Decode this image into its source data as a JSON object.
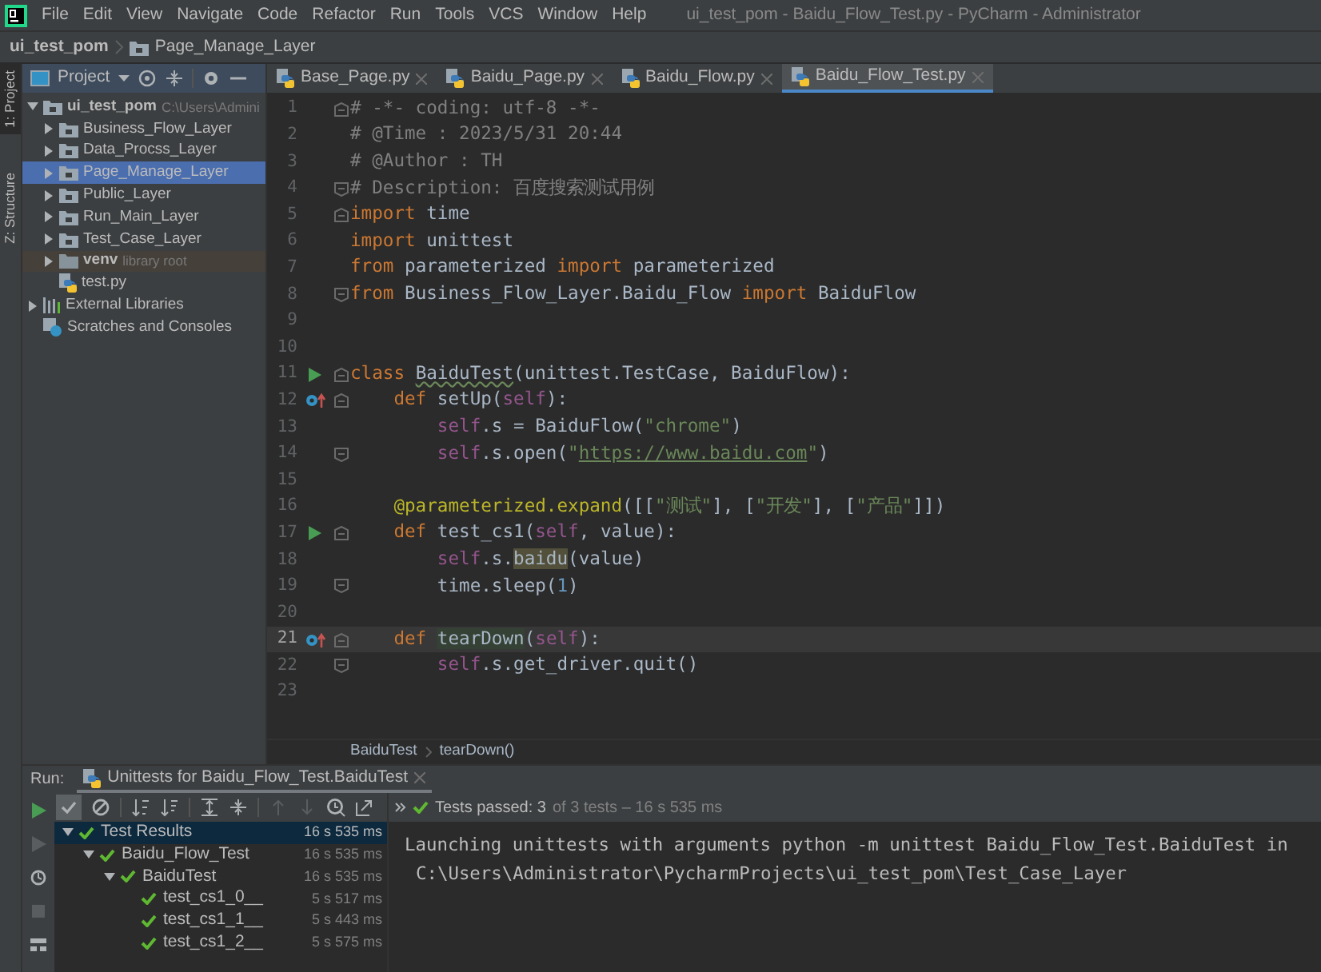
{
  "menu_bar": {
    "items": [
      "File",
      "Edit",
      "View",
      "Navigate",
      "Code",
      "Refactor",
      "Run",
      "Tools",
      "VCS",
      "Window",
      "Help"
    ],
    "title": "ui_test_pom - Baidu_Flow_Test.py - PyCharm - Administrator"
  },
  "breadcrumb": [
    "ui_test_pom",
    "Page_Manage_Layer"
  ],
  "side_tabs": [
    {
      "label": "1: Project",
      "selected": true
    },
    {
      "label": "Z: Structure",
      "selected": false
    }
  ],
  "project_panel": {
    "title": "Project",
    "tree": [
      {
        "label": "ui_test_pom",
        "hint": "C:\\Users\\Admini",
        "kind": "folder",
        "expanded": true,
        "selected": false,
        "children": [
          {
            "label": "Business_Flow_Layer",
            "kind": "folder",
            "expanded": false,
            "selected": false
          },
          {
            "label": "Data_Procss_Layer",
            "kind": "folder",
            "expanded": false,
            "selected": false
          },
          {
            "label": "Page_Manage_Layer",
            "kind": "folder",
            "expanded": false,
            "selected": true
          },
          {
            "label": "Public_Layer",
            "kind": "folder",
            "expanded": false,
            "selected": false
          },
          {
            "label": "Run_Main_Layer",
            "kind": "folder",
            "expanded": false,
            "selected": false
          },
          {
            "label": "Test_Case_Layer",
            "kind": "folder",
            "expanded": false,
            "selected": false
          },
          {
            "label": "venv",
            "hint": "library root",
            "kind": "library",
            "expanded": false,
            "selected": false
          },
          {
            "label": "test.py",
            "kind": "file",
            "selected": false
          }
        ]
      },
      {
        "label": "External Libraries",
        "kind": "libraries",
        "expanded": false,
        "selected": false
      },
      {
        "label": "Scratches and Consoles",
        "kind": "scratches",
        "selected": false
      }
    ]
  },
  "editor_tabs": [
    {
      "label": "Base_Page.py",
      "selected": false
    },
    {
      "label": "Baidu_Page.py",
      "selected": false
    },
    {
      "label": "Baidu_Flow.py",
      "selected": false
    },
    {
      "label": "Baidu_Flow_Test.py",
      "selected": true
    }
  ],
  "code_lines": [
    {
      "number": "1",
      "run_marker": false,
      "override_marker": false,
      "fold_start": true,
      "fold_end": false,
      "current": false,
      "tokens": [
        {
          "kind": "comment",
          "text": "# -*- coding: utf-8 -*-"
        }
      ]
    },
    {
      "number": "2",
      "run_marker": false,
      "override_marker": false,
      "fold_start": false,
      "fold_end": false,
      "current": false,
      "tokens": [
        {
          "kind": "comment",
          "text": "# @Time : 2023/5/31 20:44"
        }
      ]
    },
    {
      "number": "3",
      "run_marker": false,
      "override_marker": false,
      "fold_start": false,
      "fold_end": false,
      "current": false,
      "tokens": [
        {
          "kind": "comment",
          "text": "# @Author : TH"
        }
      ]
    },
    {
      "number": "4",
      "run_marker": false,
      "override_marker": false,
      "fold_start": false,
      "fold_end": true,
      "current": false,
      "tokens": [
        {
          "kind": "comment",
          "text": "# Description: 百度搜索测试用例"
        }
      ]
    },
    {
      "number": "5",
      "run_marker": false,
      "override_marker": false,
      "fold_start": true,
      "fold_end": false,
      "current": false,
      "tokens": [
        {
          "kind": "keyword",
          "text": "import"
        },
        {
          "kind": "plain",
          "text": " time"
        }
      ]
    },
    {
      "number": "6",
      "run_marker": false,
      "override_marker": false,
      "fold_start": false,
      "fold_end": false,
      "current": false,
      "tokens": [
        {
          "kind": "keyword",
          "text": "import"
        },
        {
          "kind": "plain",
          "text": " unittest"
        }
      ]
    },
    {
      "number": "7",
      "run_marker": false,
      "override_marker": false,
      "fold_start": false,
      "fold_end": false,
      "current": false,
      "tokens": [
        {
          "kind": "keyword",
          "text": "from"
        },
        {
          "kind": "plain",
          "text": " parameterized "
        },
        {
          "kind": "keyword",
          "text": "import"
        },
        {
          "kind": "plain",
          "text": " parameterized"
        }
      ]
    },
    {
      "number": "8",
      "run_marker": false,
      "override_marker": false,
      "fold_start": false,
      "fold_end": true,
      "current": false,
      "tokens": [
        {
          "kind": "keyword",
          "text": "from"
        },
        {
          "kind": "plain",
          "text": " Business_Flow_Layer.Baidu_Flow "
        },
        {
          "kind": "keyword",
          "text": "import"
        },
        {
          "kind": "plain",
          "text": " BaiduFlow"
        }
      ]
    },
    {
      "number": "9",
      "run_marker": false,
      "override_marker": false,
      "fold_start": false,
      "fold_end": false,
      "current": false
    },
    {
      "number": "10",
      "run_marker": false,
      "override_marker": false,
      "fold_start": false,
      "fold_end": false,
      "current": false
    },
    {
      "number": "11",
      "run_marker": true,
      "override_marker": false,
      "fold_start": true,
      "fold_end": false,
      "current": false,
      "tokens": [
        {
          "kind": "keyword",
          "text": "class "
        },
        {
          "kind": "typo",
          "text": "BaiduTest"
        },
        {
          "kind": "plain",
          "text": "(unittest.TestCase, BaiduFlow):"
        }
      ]
    },
    {
      "number": "12",
      "run_marker": false,
      "override_marker": true,
      "fold_start": true,
      "fold_end": false,
      "current": false,
      "tokens": [
        {
          "kind": "keyword",
          "text": "    def"
        },
        {
          "kind": "plain",
          "text": " setUp("
        },
        {
          "kind": "self",
          "text": "self"
        },
        {
          "kind": "plain",
          "text": "):"
        }
      ]
    },
    {
      "number": "13",
      "run_marker": false,
      "override_marker": false,
      "fold_start": false,
      "fold_end": false,
      "current": false,
      "tokens": [
        {
          "kind": "self",
          "text": "        self"
        },
        {
          "kind": "plain",
          "text": ".s = BaiduFlow("
        },
        {
          "kind": "string",
          "text": "\"chrome\""
        },
        {
          "kind": "plain",
          "text": ")"
        }
      ]
    },
    {
      "number": "14",
      "run_marker": false,
      "override_marker": false,
      "fold_start": false,
      "fold_end": true,
      "current": false,
      "tokens": [
        {
          "kind": "self",
          "text": "        self"
        },
        {
          "kind": "plain",
          "text": ".s.open("
        },
        {
          "kind": "string",
          "text": "\""
        },
        {
          "kind": "link",
          "text": "https://www.baidu.com"
        },
        {
          "kind": "string",
          "text": "\""
        },
        {
          "kind": "plain",
          "text": ")"
        }
      ]
    },
    {
      "number": "15",
      "run_marker": false,
      "override_marker": false,
      "fold_start": false,
      "fold_end": false,
      "current": false
    },
    {
      "number": "16",
      "run_marker": false,
      "override_marker": false,
      "fold_start": false,
      "fold_end": false,
      "current": false,
      "tokens": [
        {
          "kind": "decorator",
          "text": "    @parameterized.expand"
        },
        {
          "kind": "plain",
          "text": "([["
        },
        {
          "kind": "string",
          "text": "\"测试\""
        },
        {
          "kind": "plain",
          "text": "], ["
        },
        {
          "kind": "string",
          "text": "\"开发\""
        },
        {
          "kind": "plain",
          "text": "], ["
        },
        {
          "kind": "string",
          "text": "\"产品\""
        },
        {
          "kind": "plain",
          "text": "]])"
        }
      ]
    },
    {
      "number": "17",
      "run_marker": true,
      "override_marker": false,
      "fold_start": true,
      "fold_end": false,
      "current": false,
      "tokens": [
        {
          "kind": "keyword",
          "text": "    def"
        },
        {
          "kind": "plain",
          "text": " test_cs1("
        },
        {
          "kind": "self",
          "text": "self"
        },
        {
          "kind": "plain",
          "text": ", value):"
        }
      ]
    },
    {
      "number": "18",
      "run_marker": false,
      "override_marker": false,
      "fold_start": false,
      "fold_end": false,
      "current": false,
      "tokens": [
        {
          "kind": "self",
          "text": "        self"
        },
        {
          "kind": "plain",
          "text": ".s."
        },
        {
          "kind": "match",
          "text": "baidu"
        },
        {
          "kind": "plain",
          "text": "(value)"
        }
      ]
    },
    {
      "number": "19",
      "run_marker": false,
      "override_marker": false,
      "fold_start": false,
      "fold_end": true,
      "current": false,
      "tokens": [
        {
          "kind": "plain",
          "text": "        time.sleep("
        },
        {
          "kind": "number",
          "text": "1"
        },
        {
          "kind": "plain",
          "text": ")"
        }
      ]
    },
    {
      "number": "20",
      "run_marker": false,
      "override_marker": false,
      "fold_start": false,
      "fold_end": false,
      "current": false
    },
    {
      "number": "21",
      "run_marker": false,
      "override_marker": true,
      "fold_start": true,
      "fold_end": false,
      "current": true,
      "tokens": [
        {
          "kind": "keyword",
          "text": "    def "
        },
        {
          "kind": "identifier",
          "text": "tearDown"
        },
        {
          "kind": "plain",
          "text": "("
        },
        {
          "kind": "self",
          "text": "self"
        },
        {
          "kind": "plain",
          "text": "):"
        }
      ]
    },
    {
      "number": "22",
      "run_marker": false,
      "override_marker": false,
      "fold_start": false,
      "fold_end": true,
      "current": false,
      "tokens": [
        {
          "kind": "self",
          "text": "        self"
        },
        {
          "kind": "plain",
          "text": ".s.get_driver.quit()"
        }
      ]
    },
    {
      "number": "23",
      "run_marker": false,
      "override_marker": false,
      "fold_start": false,
      "fold_end": false,
      "current": false
    }
  ],
  "editor_breadcrumb": [
    "BaiduTest",
    "tearDown()"
  ],
  "run_panel": {
    "label": "Run:",
    "tab": "Unittests for Baidu_Flow_Test.BaiduTest",
    "show_passed": true,
    "status_main": "Tests passed: 3",
    "status_detail": "of 3 tests – 16 s 535 ms",
    "results": [
      {
        "label": "Test Results",
        "time": "16 s 535 ms",
        "passed": true,
        "selected": true,
        "children": [
          {
            "label": "Baidu_Flow_Test",
            "time": "16 s 535 ms",
            "passed": true,
            "selected": false,
            "children": [
              {
                "label": "BaiduTest",
                "time": "16 s 535 ms",
                "passed": true,
                "selected": false,
                "children": [
                  {
                    "label": "test_cs1_0__",
                    "time": "5 s 517 ms",
                    "passed": true,
                    "selected": false
                  },
                  {
                    "label": "test_cs1_1__",
                    "time": "5 s 443 ms",
                    "passed": true,
                    "selected": false
                  },
                  {
                    "label": "test_cs1_2__",
                    "time": "5 s 575 ms",
                    "passed": true,
                    "selected": false
                  }
                ]
              }
            ]
          }
        ]
      }
    ],
    "console": [
      "Launching unittests with arguments python -m unittest Baidu_Flow_Test.BaiduTest in",
      "C:\\Users\\Administrator\\PycharmProjects\\ui_test_pom\\Test_Case_Layer"
    ]
  }
}
